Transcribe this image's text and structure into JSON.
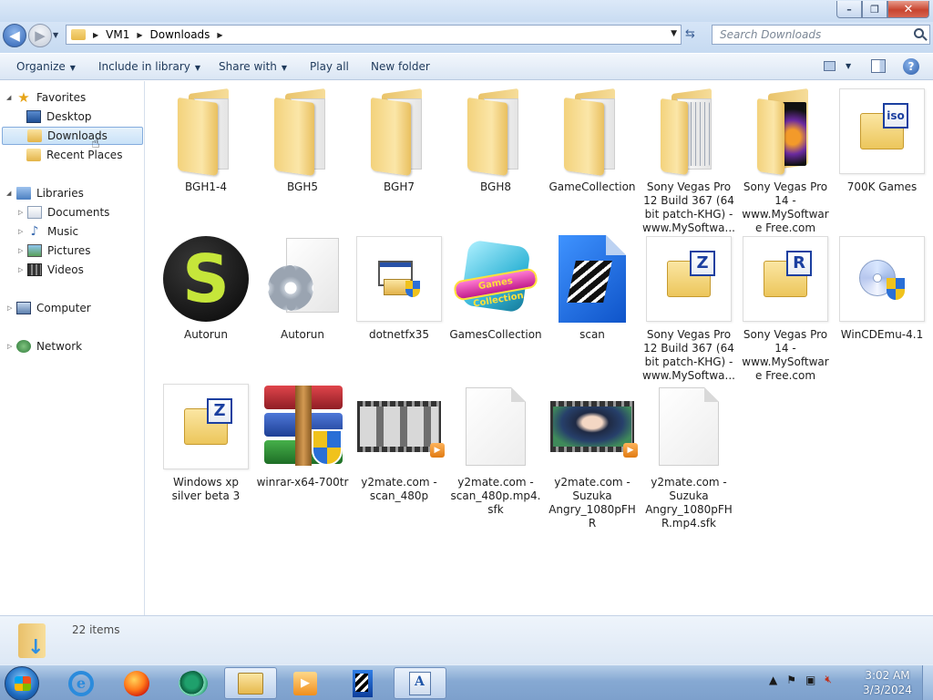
{
  "address": {
    "crumbs": [
      "VM1",
      "Downloads"
    ],
    "search_placeholder": "Search Downloads"
  },
  "window_buttons": {
    "minimize": "–",
    "maximize": "❐",
    "close": "✕"
  },
  "toolbar": {
    "organize": "Organize",
    "include_in_library": "Include in library",
    "share_with": "Share with",
    "play_all": "Play all",
    "new_folder": "New folder",
    "help": "?"
  },
  "nav": {
    "favorites": "Favorites",
    "desktop": "Desktop",
    "downloads": "Downloads",
    "recent_places": "Recent Places",
    "libraries": "Libraries",
    "documents": "Documents",
    "music": "Music",
    "pictures": "Pictures",
    "videos": "Videos",
    "computer": "Computer",
    "network": "Network"
  },
  "files": {
    "f0": "BGH1-4",
    "f1": "BGH5",
    "f2": "BGH7",
    "f3": "BGH8",
    "f4": "GameCollection",
    "f5": "Sony Vegas Pro 12 Build 367 (64 bit patch-KHG) - www.MySoftwa...",
    "f6": "Sony Vegas Pro 14 - www.MySoftware Free.com",
    "f7": "700K Games",
    "f8": "Autorun",
    "f9": "Autorun",
    "f10": "dotnetfx35",
    "f11": "GamesCollection",
    "f12": "scan",
    "f13": "Sony Vegas Pro 12 Build 367 (64 bit patch-KHG) - www.MySoftwa...",
    "f14": "Sony Vegas Pro 14 - www.MySoftware Free.com",
    "f15": "WinCDEmu-4.1",
    "f16": "Windows xp silver beta 3",
    "f17": "winrar-x64-700tr",
    "f18": "y2mate.com - scan_480p",
    "f19": "y2mate.com - scan_480p.mp4.sfk",
    "f20": "y2mate.com - Suzuka Angry_1080pFHR",
    "f21": "y2mate.com - Suzuka Angry_1080pFHR.mp4.sfk"
  },
  "icons": {
    "archive_z": "Z",
    "archive_r": "R",
    "iso": "iso",
    "games_text": "Games Collection",
    "autorun_s": "S"
  },
  "status": {
    "item_count": "22 items"
  },
  "clock": {
    "time": "3:02 AM",
    "date": "3/3/2024"
  },
  "colors": {
    "selection": "#c9e2f8",
    "taskbar": "#86a9d3",
    "folder": "#f3d27c"
  }
}
